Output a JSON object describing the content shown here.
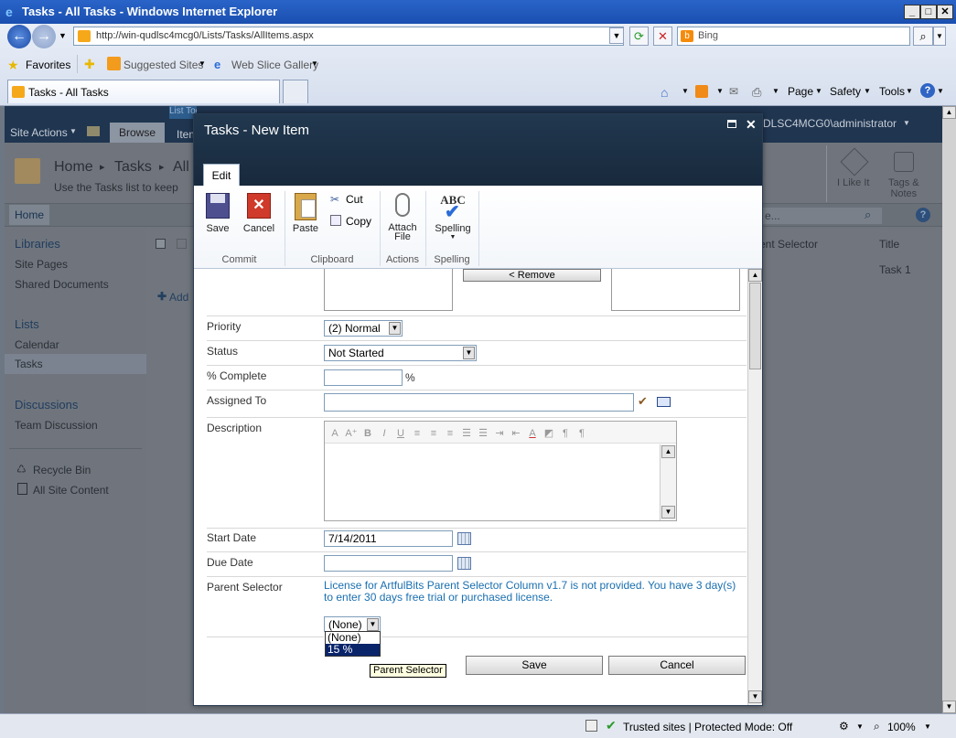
{
  "window": {
    "title": "Tasks - All Tasks - Windows Internet Explorer"
  },
  "browser": {
    "address": "http://win-qudlsc4mcg0/Lists/Tasks/AllItems.aspx",
    "search_placeholder": "Bing",
    "favorites_label": "Favorites",
    "suggested_sites": "Suggested Sites",
    "web_slice_gallery": "Web Slice Gallery",
    "tab_title": "Tasks - All Tasks",
    "commands": {
      "page": "Page",
      "safety": "Safety",
      "tools": "Tools"
    }
  },
  "sharepoint": {
    "site_actions": "Site Actions",
    "browse_tab": "Browse",
    "items_tab": "Item",
    "list_tools": "List Tools",
    "user": "DLSC4MCG0\\administrator",
    "breadcrumb": {
      "home": "Home",
      "tasks": "Tasks",
      "all": "All"
    },
    "description": "Use the Tasks list to keep",
    "i_like_it": "I Like It",
    "tags_notes": "Tags &\nNotes",
    "top_nav_home": "Home",
    "search_ph": "e...",
    "quick_launch": {
      "libraries": "Libraries",
      "site_pages": "Site Pages",
      "shared_documents": "Shared Documents",
      "lists": "Lists",
      "calendar": "Calendar",
      "tasks": "Tasks",
      "discussions": "Discussions",
      "team_discussion": "Team Discussion",
      "recycle_bin": "Recycle Bin",
      "all_site_content": "All Site Content"
    },
    "list": {
      "add": "Add",
      "col_parent": "ent Selector",
      "col_title": "Title",
      "row1_title": "Task 1"
    }
  },
  "dialog": {
    "title": "Tasks - New Item",
    "edit_tab": "Edit",
    "ribbon": {
      "save": "Save",
      "cancel": "Cancel",
      "paste": "Paste",
      "cut": "Cut",
      "copy": "Copy",
      "attach_file": "Attach\nFile",
      "spelling": "Spelling",
      "groups": {
        "commit": "Commit",
        "clipboard": "Clipboard",
        "actions": "Actions",
        "spelling": "Spelling"
      }
    },
    "form": {
      "remove_button": "< Remove",
      "priority_label": "Priority",
      "priority_value": "(2) Normal",
      "status_label": "Status",
      "status_value": "Not Started",
      "percent_label": "% Complete",
      "percent_value": "",
      "percent_unit": "%",
      "assigned_label": "Assigned To",
      "assigned_value": "",
      "description_label": "Description",
      "start_label": "Start Date",
      "start_value": "7/14/2011",
      "due_label": "Due Date",
      "due_value": "",
      "parent_label": "Parent Selector",
      "license_msg": "License for ArtfulBits Parent Selector Column v1.7 is not provided. You have 3 day(s) to enter 30 days free trial or purchased license.",
      "parent_value": "(None)",
      "dropdown_options": [
        "(None)",
        "15 %"
      ],
      "tooltip": "Parent Selector",
      "save": "Save",
      "cancel": "Cancel"
    }
  },
  "status": {
    "zone": "Trusted sites | Protected Mode: Off",
    "zoom": "100%"
  }
}
